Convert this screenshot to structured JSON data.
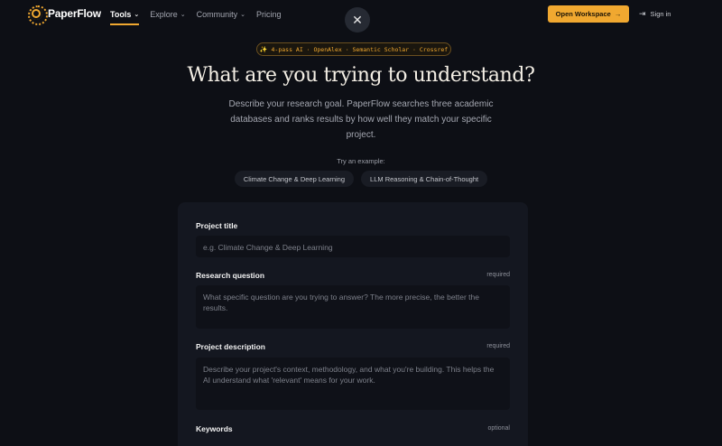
{
  "nav": {
    "brand": "PaperFlow",
    "links": [
      {
        "label": "Tools",
        "chevron": "⌄",
        "active": true
      },
      {
        "label": "Explore",
        "chevron": "⌄",
        "active": false
      },
      {
        "label": "Community",
        "chevron": "⌄",
        "active": false
      },
      {
        "label": "Pricing",
        "chevron": "",
        "active": false
      }
    ],
    "close": "✕",
    "open_workspace": "Open Workspace",
    "open_workspace_arrow": "→",
    "sign_in": "Sign in",
    "sign_in_icon": "⇥"
  },
  "hero": {
    "badge_icon": "✨",
    "badge": "4-pass AI · OpenAlex · Semantic Scholar · Crossref",
    "title": "What are you trying to understand?",
    "subtitle": "Describe your research goal. PaperFlow searches three academic databases and ranks results by how well they match your specific project.",
    "try_label": "Try an example:",
    "examples": [
      "Climate Change & Deep Learning",
      "LLM Reasoning & Chain-of-Thought"
    ]
  },
  "form": {
    "project_title": {
      "label": "Project title",
      "placeholder": "e.g. Climate Change & Deep Learning"
    },
    "research_question": {
      "label": "Research question",
      "tag": "required",
      "placeholder": "What specific question are you trying to answer? The more precise, the better the results."
    },
    "project_description": {
      "label": "Project description",
      "tag": "required",
      "placeholder": "Describe your project's context, methodology, and what you're building. This helps the AI understand what 'relevant' means for your work."
    },
    "keywords": {
      "label": "Keywords",
      "tag": "optional"
    }
  },
  "colors": {
    "accent": "#f0a830",
    "background": "#0d0f15",
    "card": "#141720"
  }
}
